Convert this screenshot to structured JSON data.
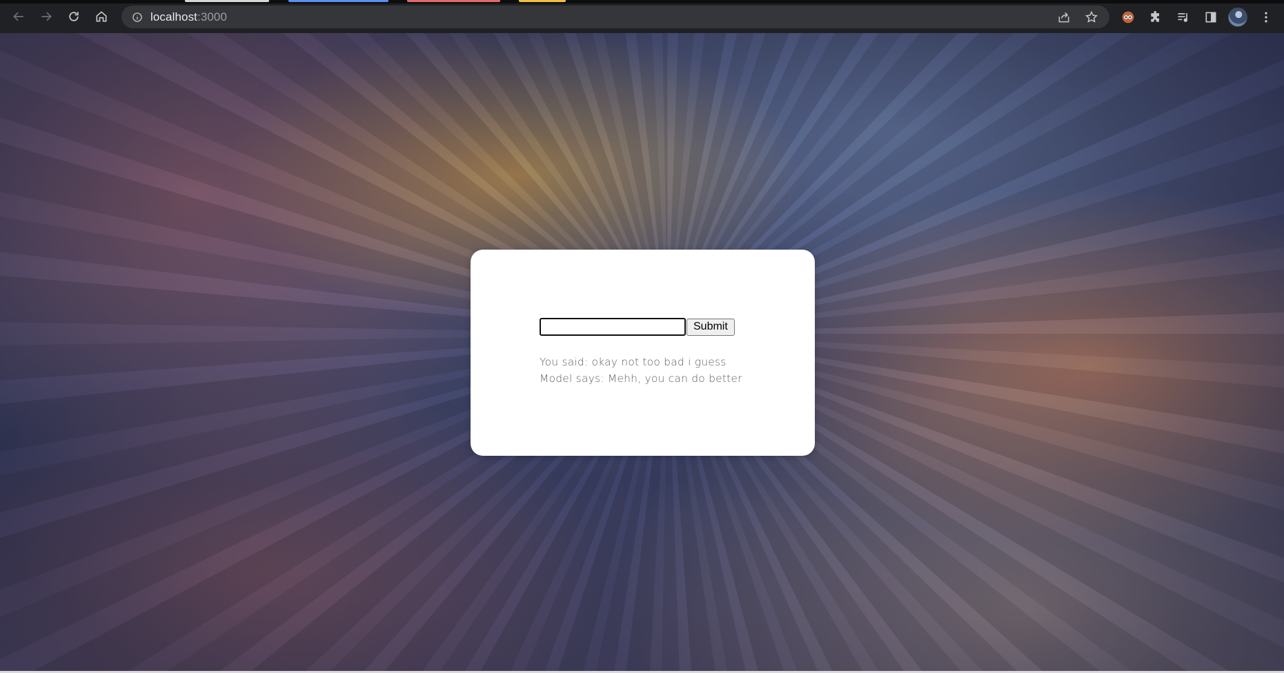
{
  "browser": {
    "url_host": "localhost",
    "url_port": ":3000",
    "tab_accent_colors": [
      "#d6d6d6",
      "#5b8ff0",
      "#e06a6a",
      "#f0c040"
    ],
    "icons": {
      "back": "arrow-left-icon",
      "forward": "arrow-right-icon",
      "reload": "reload-icon",
      "home": "home-icon",
      "site_info": "info-icon",
      "share": "share-icon",
      "bookmark": "star-icon",
      "extension_1": "owl-extension-icon",
      "extensions": "puzzle-icon",
      "media": "playlist-icon",
      "side_panel": "side-panel-icon",
      "menu": "kebab-menu-icon"
    }
  },
  "page": {
    "input": {
      "value": "",
      "placeholder": ""
    },
    "submit_label": "Submit",
    "you_said": "You said: okay not too bad i guess",
    "model_says": "Model says: Mehh, you can do better"
  }
}
